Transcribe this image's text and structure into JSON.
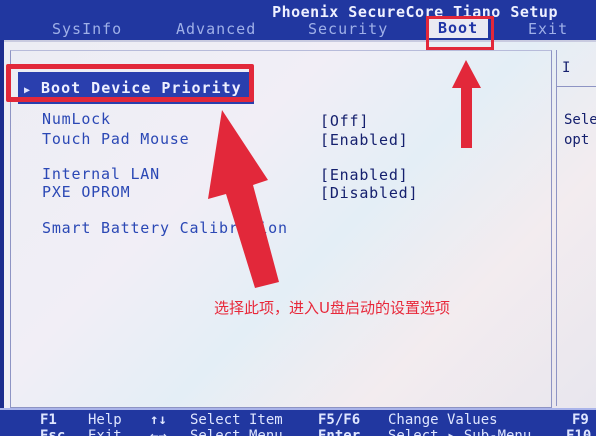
{
  "header": {
    "title": "Phoenix SecureCore Tiano Setup",
    "tabs": [
      {
        "label": "SysInfo"
      },
      {
        "label": "Advanced"
      },
      {
        "label": "Security"
      },
      {
        "label": "Boot"
      },
      {
        "label": "Exit"
      }
    ],
    "active_tab": "Boot"
  },
  "menu": {
    "boot_device_priority": "Boot Device Priority",
    "items": [
      {
        "label": "NumLock",
        "value": "[Off]"
      },
      {
        "label": "Touch Pad Mouse",
        "value": "[Enabled]"
      },
      {
        "label": "Internal LAN",
        "value": "[Enabled]"
      },
      {
        "label": "PXE OPROM",
        "value": "[Disabled]"
      },
      {
        "label": "Smart Battery Calibration",
        "value": ""
      }
    ]
  },
  "help": {
    "title": "I",
    "lines": [
      "Sele",
      "opt"
    ]
  },
  "annotation": {
    "text": "选择此项，进入U盘启动的设置选项",
    "color": "#e2283a"
  },
  "footer": {
    "row1": [
      {
        "key": "F1",
        "desc": "Help"
      },
      {
        "key": "↑↓",
        "desc": "Select Item"
      },
      {
        "key": "F5/F6",
        "desc": "Change Values"
      },
      {
        "key": "F9",
        "desc": ""
      }
    ],
    "row2": [
      {
        "key": "Esc",
        "desc": "Exit"
      },
      {
        "key": "←→",
        "desc": "Select Menu"
      },
      {
        "key": "Enter",
        "desc": "Select ▸ Sub-Menu"
      },
      {
        "key": "F10",
        "desc": ""
      }
    ]
  }
}
